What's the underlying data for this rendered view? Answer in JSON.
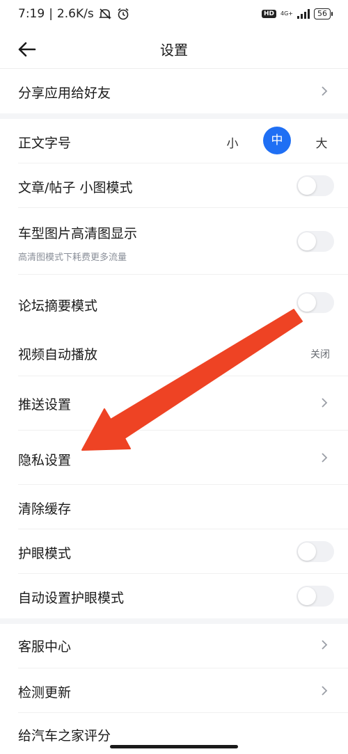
{
  "status_bar": {
    "time": "7:19",
    "net_speed": "2.6K/s",
    "hd": "HD",
    "network_type": "4G+",
    "battery": "56"
  },
  "header": {
    "back_icon": "arrow-left-icon",
    "title": "设置"
  },
  "sections": {
    "share": {
      "label": "分享应用给好友"
    },
    "font_size": {
      "label": "正文字号",
      "options": [
        "小",
        "中",
        "大"
      ],
      "selected": "中",
      "accent_color": "#1f6ff4"
    },
    "small_image_mode": {
      "label": "文章/帖子 小图模式",
      "on": false
    },
    "hd_image": {
      "label": "车型图片高清图显示",
      "sublabel": "高清图模式下耗费更多流量",
      "on": false
    },
    "forum_summary": {
      "label": "论坛摘要模式",
      "on": false
    },
    "video_autoplay": {
      "label": "视频自动播放",
      "value": "关闭"
    },
    "push_settings": {
      "label": "推送设置"
    },
    "privacy_settings": {
      "label": "隐私设置"
    },
    "clear_cache": {
      "label": "清除缓存"
    },
    "eye_protection": {
      "label": "护眼模式",
      "on": false
    },
    "auto_eye_protection": {
      "label": "自动设置护眼模式",
      "on": false
    },
    "customer_service": {
      "label": "客服中心"
    },
    "check_update": {
      "label": "检测更新"
    },
    "rate_app": {
      "label": "给汽车之家评分"
    }
  },
  "annotation": {
    "arrow_color": "#ee4324"
  }
}
